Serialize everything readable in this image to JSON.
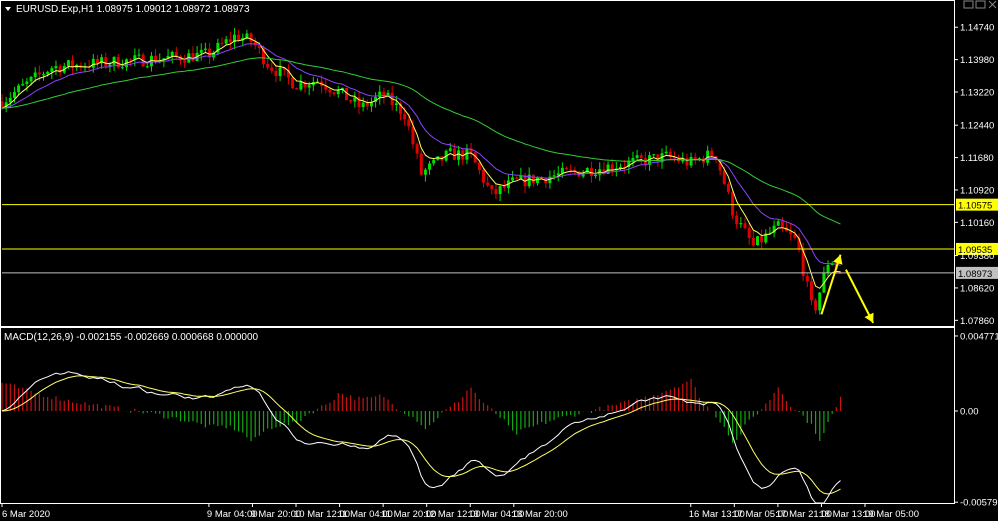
{
  "header": {
    "symbol_text": "EURUSD.Exp,H1  1.08975 1.09012 1.08972 1.08973",
    "macd_text": "MACD(12,26,9) -0.002155 -0.002669 0.000668 0.000000"
  },
  "colors": {
    "background": "#000000",
    "bull": "#00e000",
    "bear": "#e00000",
    "fast_ma": "#ffff66",
    "mid_ma": "#8844ff",
    "slow_ma": "#33cc33",
    "level": "#ffff00",
    "macd_main": "#ffffff",
    "macd_signal": "#ffff66",
    "hist_pos": "#cc1111",
    "hist_neg": "#11aa11",
    "axis": "#ffffff"
  },
  "chart_data": [
    {
      "type": "candlestick",
      "title": "EURUSD.Exp,H1",
      "ohlc_last": {
        "open": 1.08975,
        "high": 1.09012,
        "low": 1.08972,
        "close": 1.08973
      },
      "ylim": [
        1.0775,
        1.1498
      ],
      "y_ticks": [
        "1.14740",
        "1.13980",
        "1.13220",
        "1.12440",
        "1.11680",
        "1.10920",
        "1.10160",
        "1.09380",
        "1.08620",
        "1.07860"
      ],
      "x_ticks": [
        "6 Mar 2020",
        "9 Mar 04:00",
        "9 Mar 20:00",
        "10 Mar 12:00",
        "11 Mar 04:00",
        "11 Mar 20:00",
        "12 Mar 12:00",
        "13 Mar 04:00",
        "13 Mar 20:00",
        "16 Mar 13:00",
        "17 Mar 05:00",
        "17 Mar 21:00",
        "18 Mar 13:00",
        "19 Mar 05:00"
      ],
      "x_range": [
        "6 Mar 2020",
        "19 Mar 05:00"
      ],
      "candles_shown": 203,
      "trend_path": [
        {
          "t": "6 Mar 2020",
          "p": 1.13
        },
        {
          "t": "6 Mar 18:00",
          "p": 1.138
        },
        {
          "t": "9 Mar 04:00",
          "p": 1.141
        },
        {
          "t": "9 Mar 14:00",
          "p": 1.1455
        },
        {
          "t": "9 Mar 20:00",
          "p": 1.144
        },
        {
          "t": "10 Mar 02:00",
          "p": 1.1385
        },
        {
          "t": "10 Mar 12:00",
          "p": 1.134
        },
        {
          "t": "10 Mar 20:00",
          "p": 1.135
        },
        {
          "t": "11 Mar 04:00",
          "p": 1.132
        },
        {
          "t": "11 Mar 12:00",
          "p": 1.1285
        },
        {
          "t": "11 Mar 20:00",
          "p": 1.1315
        },
        {
          "t": "12 Mar 04:00",
          "p": 1.127
        },
        {
          "t": "12 Mar 10:00",
          "p": 1.113
        },
        {
          "t": "12 Mar 20:00",
          "p": 1.1175
        },
        {
          "t": "13 Mar 04:00",
          "p": 1.1175
        },
        {
          "t": "13 Mar 12:00",
          "p": 1.108
        },
        {
          "t": "13 Mar 20:00",
          "p": 1.111
        },
        {
          "t": "16 Mar 04:00",
          "p": 1.117
        },
        {
          "t": "16 Mar 13:00",
          "p": 1.1155
        },
        {
          "t": "16 Mar 22:00",
          "p": 1.118
        },
        {
          "t": "17 Mar 05:00",
          "p": 1.103
        },
        {
          "t": "17 Mar 12:00",
          "p": 1.096
        },
        {
          "t": "17 Mar 21:00",
          "p": 1.1005
        },
        {
          "t": "18 Mar 04:00",
          "p": 1.097
        },
        {
          "t": "18 Mar 10:00",
          "p": 1.08
        },
        {
          "t": "18 Mar 16:00",
          "p": 1.0935
        },
        {
          "t": "18 Mar 20:00",
          "p": 1.0895
        }
      ],
      "indicators": [
        "moving average fast",
        "moving average medium",
        "moving average slow"
      ],
      "horizontal_levels": [
        {
          "value": 1.10575,
          "label": "1.10575",
          "color": "#ffff00"
        },
        {
          "value": 1.09535,
          "label": "1.09535",
          "color": "#ffff00"
        },
        {
          "value": 1.08973,
          "label": "1.08973",
          "color": "#c0c0c0"
        }
      ],
      "annotation_arrows": [
        {
          "from": {
            "t": "18 Mar 13:00",
            "p": 1.08
          },
          "to": {
            "t": "18 Mar 20:00",
            "p": 1.094
          },
          "color": "#ffff00"
        },
        {
          "from": {
            "t": "18 Mar 22:00",
            "p": 1.0905
          },
          "to": {
            "t": "19 Mar 08:00",
            "p": 1.078
          },
          "color": "#ffff00"
        }
      ],
      "grid": false
    },
    {
      "type": "macd",
      "label": "MACD(12,26,9)",
      "values": {
        "macd": -0.002155,
        "signal": -0.002669,
        "histogram": 0.000668,
        "extra": 0.0
      },
      "ylim": [
        -0.00585,
        0.00515
      ],
      "y_ticks": [
        "0.004771",
        "0.00",
        "-0.005799"
      ],
      "histogram_profile": [
        {
          "t": "6 Mar 2020",
          "v": 0.0018
        },
        {
          "t": "9 Mar 04:00",
          "v": -0.001
        },
        {
          "t": "9 Mar 20:00",
          "v": -0.002
        },
        {
          "t": "10 Mar 12:00",
          "v": -0.0008
        },
        {
          "t": "11 Mar 04:00",
          "v": 0.0012
        },
        {
          "t": "11 Mar 20:00",
          "v": 0.001
        },
        {
          "t": "12 Mar 12:00",
          "v": -0.0012
        },
        {
          "t": "13 Mar 04:00",
          "v": 0.0016
        },
        {
          "t": "13 Mar 20:00",
          "v": -0.0015
        },
        {
          "t": "16 Mar 13:00",
          "v": 0.002
        },
        {
          "t": "17 Mar 05:00",
          "v": -0.0022
        },
        {
          "t": "17 Mar 21:00",
          "v": 0.0016
        },
        {
          "t": "18 Mar 13:00",
          "v": -0.002
        },
        {
          "t": "18 Mar 22:00",
          "v": 0.0018
        }
      ],
      "grid": false
    }
  ]
}
